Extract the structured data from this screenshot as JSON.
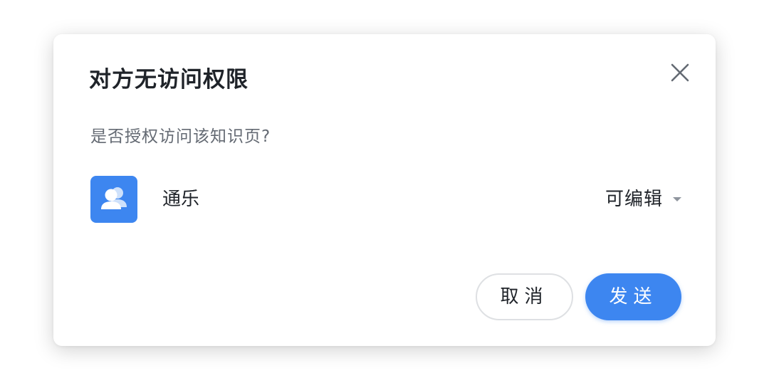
{
  "dialog": {
    "title": "对方无访问权限",
    "subtitle": "是否授权访问该知识页?",
    "close_icon": "close-icon",
    "member": {
      "avatar_icon": "group-users-icon",
      "name": "通乐",
      "permission": "可编辑"
    },
    "buttons": {
      "cancel": "取消",
      "send": "发送"
    },
    "colors": {
      "accent": "#3d86f0",
      "title_text": "#1f2329",
      "secondary_text": "#646a73"
    }
  }
}
